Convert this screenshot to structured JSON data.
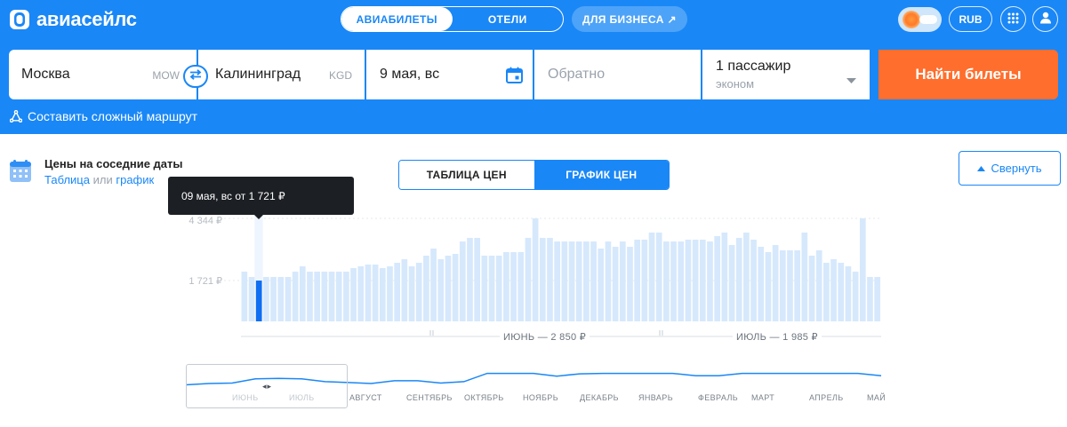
{
  "header": {
    "logo_text": "авиасейлс",
    "tabs": [
      {
        "label": "АВИАБИЛЕТЫ",
        "active": true
      },
      {
        "label": "ОТЕЛИ",
        "active": false
      }
    ],
    "business_label": "ДЛЯ БИЗНЕСА ↗",
    "currency_label": "RUB",
    "brand_color": "#1a87f6"
  },
  "search": {
    "origin": {
      "city": "Москва",
      "code": "MOW"
    },
    "destination": {
      "city": "Калининград",
      "code": "KGD"
    },
    "depart_date": "9 мая, вс",
    "return_placeholder": "Обратно",
    "passengers": "1 пассажир",
    "cabin_class": "эконом",
    "find_label": "Найти билеты",
    "find_color": "#ff6e2c",
    "complex_route_label": "Составить сложный маршрут"
  },
  "nearby": {
    "title": "Цены на соседние даты",
    "table_link": "Таблица",
    "or_text": "или",
    "chart_link": "график",
    "view_tabs": [
      {
        "label": "ТАБЛИЦА ЦЕН",
        "active": false
      },
      {
        "label": "ГРАФИК ЦЕН",
        "active": true
      }
    ],
    "collapse_label": "Свернуть"
  },
  "tooltip": {
    "text": "09 мая, вс от 1 721 ₽"
  },
  "chart_data": {
    "type": "bar",
    "y_ticks": [
      "4 344 ₽",
      "1 721 ₽"
    ],
    "ylim": [
      0,
      4344
    ],
    "selected_index": 2,
    "values": [
      2096,
      1871,
      1721,
      1871,
      1871,
      1871,
      1871,
      2096,
      2321,
      2096,
      2096,
      2096,
      2096,
      2096,
      2096,
      2246,
      2321,
      2396,
      2396,
      2246,
      2321,
      2471,
      2621,
      2321,
      2471,
      2771,
      3071,
      2621,
      2771,
      2846,
      3371,
      3521,
      3521,
      2771,
      2771,
      2771,
      2921,
      2921,
      2921,
      3521,
      4344,
      3521,
      3521,
      3371,
      3371,
      3371,
      3371,
      3371,
      3371,
      3071,
      3371,
      3146,
      3371,
      3146,
      3446,
      3446,
      3746,
      3746,
      3371,
      3371,
      3371,
      3446,
      3446,
      3446,
      3371,
      3596,
      3746,
      3221,
      3521,
      3746,
      3446,
      3146,
      2921,
      3221,
      2996,
      2996,
      2996,
      3746,
      2771,
      2996,
      2471,
      2621,
      2471,
      2321,
      2096,
      4344,
      1871,
      1871
    ],
    "series_color": "#d6e8fc",
    "selected_color": "#0f6ef2",
    "month_summaries": [
      "ИЮНЬ — 2 850 ₽",
      "ИЮЛЬ — 1 985 ₽"
    ],
    "navigator_months": [
      "ИЮНЬ",
      "ИЮЛЬ",
      "АВГУСТ",
      "СЕНТЯБРЬ",
      "ОКТЯБРЬ",
      "НОЯБРЬ",
      "ДЕКАБРЬ",
      "ЯНВАРЬ",
      "ФЕВРАЛЬ",
      "МАРТ",
      "АПРЕЛЬ",
      "МАЙ"
    ],
    "navigator_line": [
      2096,
      2321,
      2396,
      3071,
      3146,
      3071,
      2621,
      2471,
      2321,
      2771,
      2771,
      2396,
      2621,
      3971,
      3971,
      3971,
      3521,
      3896,
      3971,
      3971,
      3971,
      3971,
      3596,
      3596,
      3971,
      3971,
      3971,
      3971,
      3971,
      3971,
      3596
    ]
  }
}
